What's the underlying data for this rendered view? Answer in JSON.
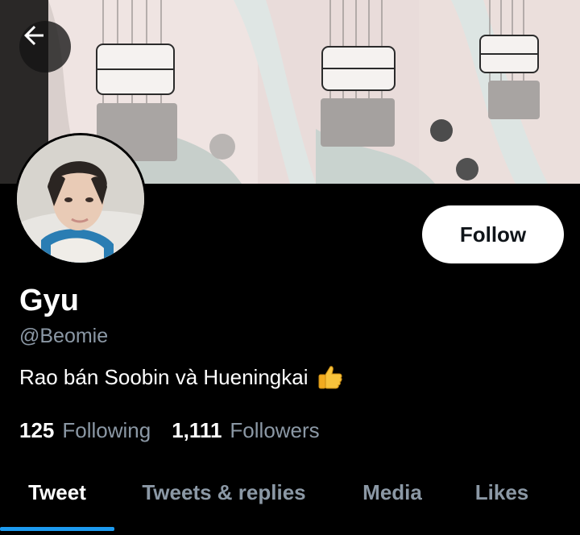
{
  "header": {
    "back_icon": "arrow-left-icon",
    "banner_description_icon": "banner-image"
  },
  "profile": {
    "display_name": "Gyu",
    "handle": "@Beomie",
    "bio": "Rao bán Soobin và Hueningkai",
    "bio_emoji_icon": "thumbs-up-icon",
    "follow_label": "Follow"
  },
  "stats": {
    "following_count": "125",
    "following_label": "Following",
    "followers_count": "1,111",
    "followers_label": "Followers"
  },
  "tabs": [
    {
      "label": "Tweet",
      "active": true
    },
    {
      "label": "Tweets & replies",
      "active": false
    },
    {
      "label": "Media",
      "active": false
    },
    {
      "label": "Likes",
      "active": false
    }
  ],
  "colors": {
    "background": "#000000",
    "accent": "#1d9bf0",
    "secondary_text": "#8b98a5",
    "follow_button_bg": "#ffffff"
  }
}
